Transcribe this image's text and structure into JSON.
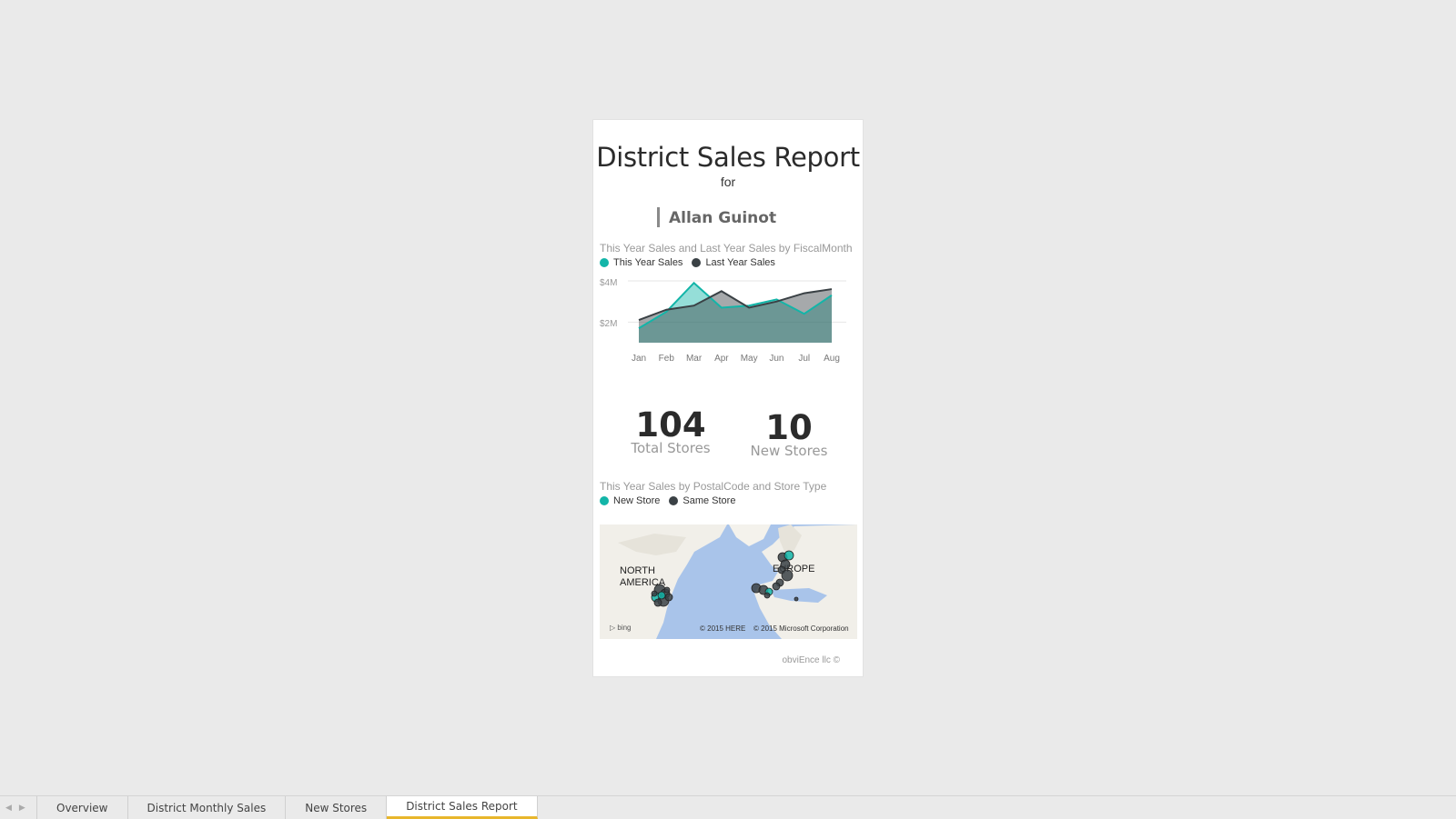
{
  "report": {
    "title": "District Sales Report",
    "for_label": "for",
    "user_name": "Allan Guinot",
    "footer": "obviEnce llc ©"
  },
  "line_chart": {
    "title": "This Year Sales and Last Year Sales by FiscalMonth",
    "legend": [
      "This Year Sales",
      "Last Year Sales"
    ],
    "colors": {
      "this_year": "#13b5a8",
      "last_year": "#3a4145"
    },
    "y_ticks": [
      "$4M",
      "$2M"
    ]
  },
  "chart_data": {
    "type": "area",
    "categories": [
      "Jan",
      "Feb",
      "Mar",
      "Apr",
      "May",
      "Jun",
      "Jul",
      "Aug"
    ],
    "series": [
      {
        "name": "This Year Sales",
        "values": [
          1.7,
          2.5,
          3.9,
          2.7,
          2.8,
          3.1,
          2.4,
          3.3
        ]
      },
      {
        "name": "Last Year Sales",
        "values": [
          2.1,
          2.6,
          2.8,
          3.5,
          2.7,
          3.0,
          3.4,
          3.6
        ]
      }
    ],
    "ylim": [
      1.0,
      4.0
    ],
    "y_ticks": [
      2,
      4
    ],
    "grid": true,
    "legend_position": "top-left"
  },
  "kpis": [
    {
      "value": "104",
      "label": "Total Stores"
    },
    {
      "value": "10",
      "label": "New Stores"
    }
  ],
  "map_chart": {
    "title": "This Year Sales by PostalCode and Store Type",
    "legend": [
      "New Store",
      "Same Store"
    ],
    "colors": {
      "new_store": "#13b5a8",
      "same_store": "#3a4145"
    },
    "region_labels": [
      "NORTH\nAMERICA",
      "EUROPE"
    ],
    "bing_label": "bing",
    "credit_here": "© 2015 HERE",
    "credit_microsoft": "© 2015 Microsoft Corporation"
  },
  "tabs": [
    {
      "label": "Overview",
      "active": false
    },
    {
      "label": "District Monthly Sales",
      "active": false
    },
    {
      "label": "New Stores",
      "active": false
    },
    {
      "label": "District Sales Report",
      "active": true
    }
  ]
}
